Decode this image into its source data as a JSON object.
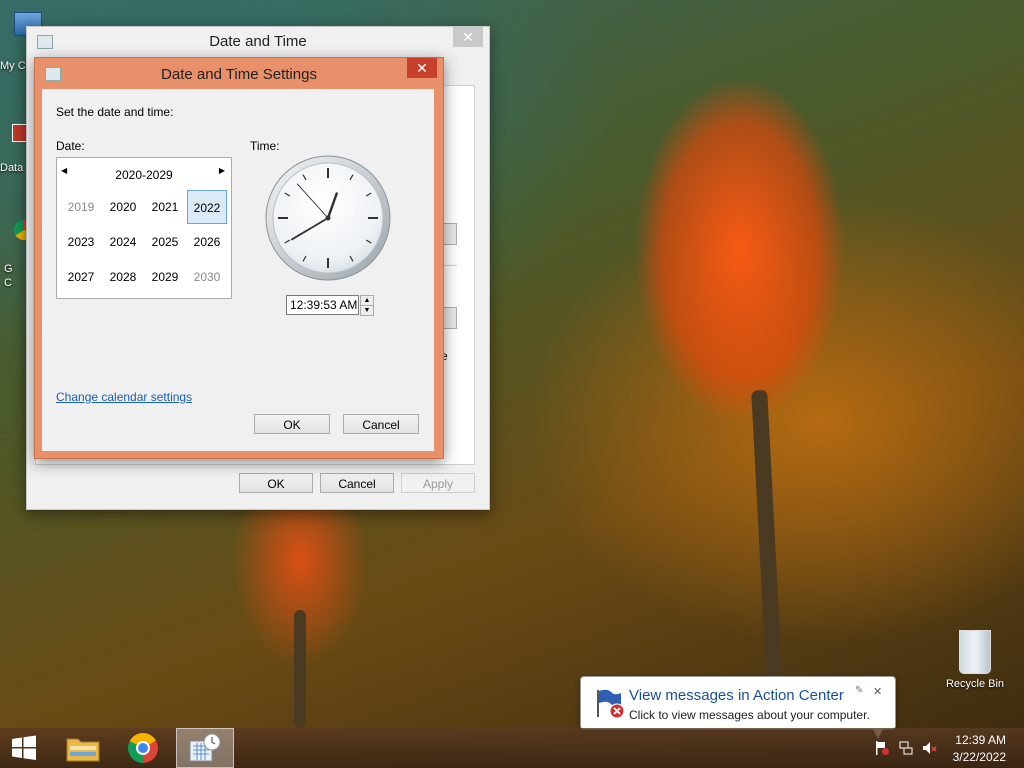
{
  "desktop": {
    "icons": [
      {
        "label": "My C"
      },
      {
        "label": "Data"
      },
      {
        "label": "G\nC"
      },
      {
        "label": "Recycle Bin"
      }
    ]
  },
  "outer_window": {
    "title": "Date and Time",
    "close": "✕",
    "buttons": {
      "ok": "OK",
      "cancel": "Cancel",
      "apply": "Apply"
    },
    "partial_text": "e"
  },
  "dialog": {
    "title": "Date and Time Settings",
    "close": "✕",
    "instruction": "Set the date and time:",
    "date_label": "Date:",
    "time_label": "Time:",
    "calendar": {
      "header": "2020-2029",
      "prev": "◀",
      "next": "▶",
      "years": [
        {
          "label": "2019",
          "state": "dim"
        },
        {
          "label": "2020",
          "state": "normal"
        },
        {
          "label": "2021",
          "state": "normal"
        },
        {
          "label": "2022",
          "state": "selected"
        },
        {
          "label": "2023",
          "state": "normal"
        },
        {
          "label": "2024",
          "state": "normal"
        },
        {
          "label": "2025",
          "state": "normal"
        },
        {
          "label": "2026",
          "state": "normal"
        },
        {
          "label": "2027",
          "state": "normal"
        },
        {
          "label": "2028",
          "state": "normal"
        },
        {
          "label": "2029",
          "state": "normal"
        },
        {
          "label": "2030",
          "state": "dim"
        }
      ]
    },
    "clock": {
      "hours": 0,
      "minutes": 39,
      "seconds": 53
    },
    "time_value": "12:39:53 AM",
    "spinner_up": "▲",
    "spinner_down": "▼",
    "change_calendar_link": "Change calendar settings",
    "buttons": {
      "ok": "OK",
      "cancel": "Cancel"
    }
  },
  "notification": {
    "title": "View messages in Action Center",
    "body": "Click to view messages about your computer.",
    "close": "✕"
  },
  "taskbar": {
    "time": "12:39 AM",
    "date": "3/22/2022"
  },
  "colors": {
    "dialog_border": "#e8906a",
    "dialog_close": "#c7402c",
    "selection": "#dbeaf7",
    "link": "#1a5fb4"
  }
}
